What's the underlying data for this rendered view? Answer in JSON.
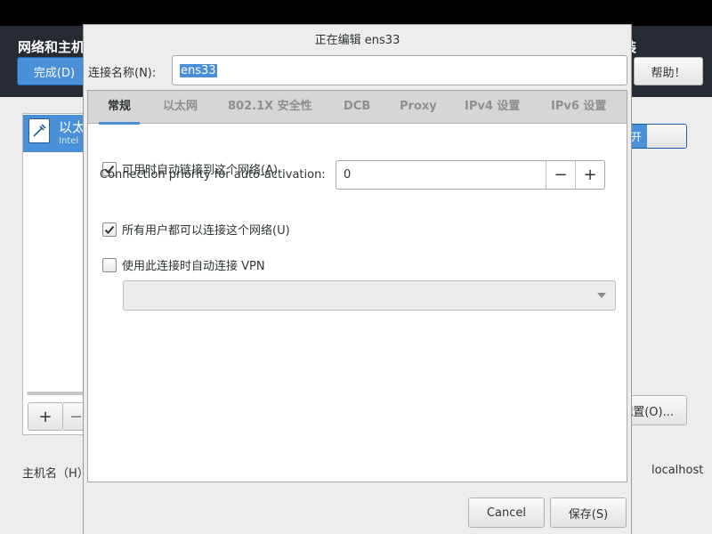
{
  "background": {
    "title": "网络和主机",
    "title_right": "装",
    "done_label": "完成(D)",
    "help_label": "帮助！",
    "list_item_title": "以太",
    "list_item_subtitle": "Intel",
    "add_label": "+",
    "remove_label": "−",
    "toggle_label": "开",
    "configure_label": "配置(O)...",
    "hostname_label": "主机名（H）",
    "hostname_colon": "：",
    "current_hostname": "localhost"
  },
  "dialog": {
    "title": "正在编辑 ens33",
    "name_label": "连接名称(N):",
    "name_value": "ens33",
    "tabs": [
      {
        "label": "常规",
        "active": true
      },
      {
        "label": "以太网",
        "active": false
      },
      {
        "label": "802.1X 安全性",
        "active": false
      },
      {
        "label": "DCB",
        "active": false
      },
      {
        "label": "Proxy",
        "active": false
      },
      {
        "label": "IPv4 设置",
        "active": false
      },
      {
        "label": "IPv6 设置",
        "active": false
      }
    ],
    "general": {
      "auto_connect_label": "可用时自动链接到这个网络(A)",
      "auto_connect_checked": true,
      "priority_label": "Connection priority for auto-activation:",
      "priority_value": "0",
      "priority_minus": "−",
      "priority_plus": "+",
      "all_users_label": "所有用户都可以连接这个网络(U)",
      "all_users_checked": true,
      "vpn_label": "使用此连接时自动连接 VPN",
      "vpn_checked": false,
      "vpn_selection": ""
    },
    "cancel_label": "Cancel",
    "save_label": "保存(S)"
  },
  "colors": {
    "accent": "#4a90d9",
    "header_bg": "#252a33",
    "dialog_bg": "#ededed"
  }
}
